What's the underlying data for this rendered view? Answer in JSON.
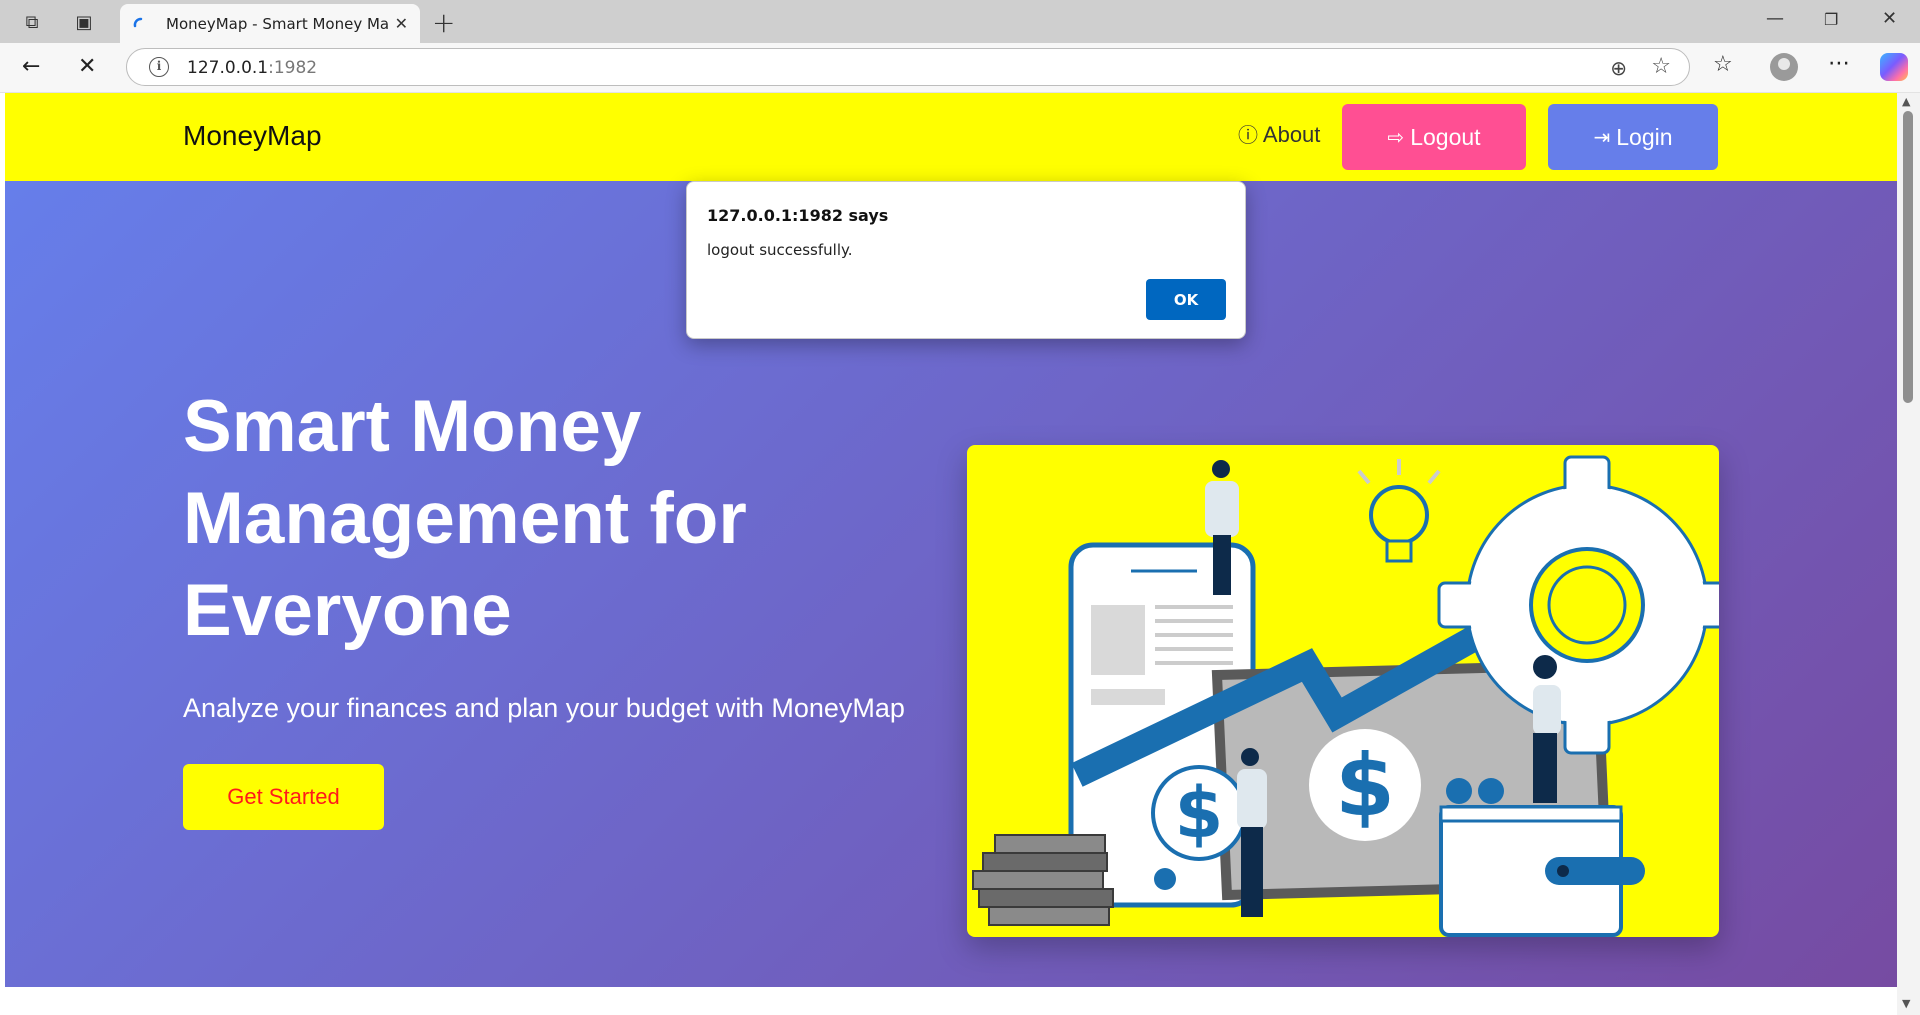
{
  "browser": {
    "tab_title": "MoneyMap - Smart Money Management",
    "tab_close": "✕",
    "new_tab": "+",
    "url_host": "127.0.0.1",
    "url_port": ":1982"
  },
  "nav": {
    "brand": "MoneyMap",
    "about": "About",
    "logout": "Logout",
    "login": "Login"
  },
  "hero": {
    "title": "Smart Money Management for Everyone",
    "subtitle": "Analyze your finances and plan your budget with MoneyMap",
    "cta": "Get Started"
  },
  "dialog": {
    "title": "127.0.0.1:1982 says",
    "message": "logout successfully.",
    "ok": "OK"
  },
  "colors": {
    "nav_bg": "#ffff00",
    "logout_btn": "#ff4f93",
    "login_btn": "#667eea",
    "hero_gradient_start": "#667eea",
    "hero_gradient_end": "#764ba2",
    "cta_bg": "#ffff00",
    "cta_text": "#ff1a1a",
    "dialog_ok": "#0067c0"
  },
  "icons": [
    "workspaces-icon",
    "tab-actions-icon",
    "back-icon",
    "stop-icon",
    "info-icon",
    "zoom-icon",
    "favorite-icon",
    "favorites-icon",
    "profile-avatar",
    "more-icon",
    "copilot-icon",
    "logout-icon",
    "login-icon"
  ]
}
